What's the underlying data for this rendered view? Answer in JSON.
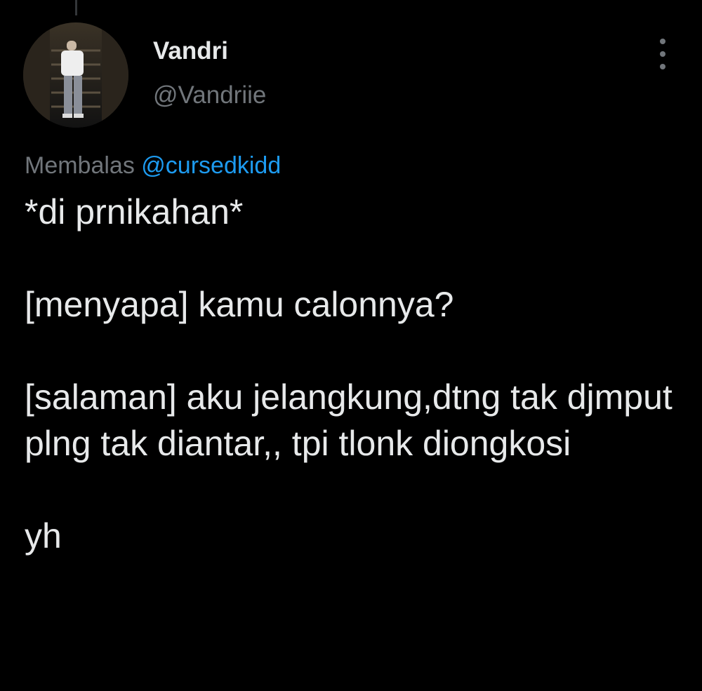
{
  "author": {
    "display_name": "Vandri",
    "handle": "@Vandriie",
    "avatar_icon": "profile-photo"
  },
  "menu": {
    "icon": "more-vertical-icon"
  },
  "reply": {
    "prefix": "Membalas",
    "mention": "@cursedkidd"
  },
  "tweet": {
    "paragraphs": [
      "*di prnikahan*",
      "[menyapa] kamu calonnya?",
      "[salaman] aku jelangkung,dtng tak djmput plng tak diantar,, tpi tlonk diongkosi",
      "yh"
    ]
  },
  "colors": {
    "background": "#000000",
    "text_primary": "#e7e9ea",
    "text_secondary": "#71767b",
    "link": "#1d9bf0"
  }
}
